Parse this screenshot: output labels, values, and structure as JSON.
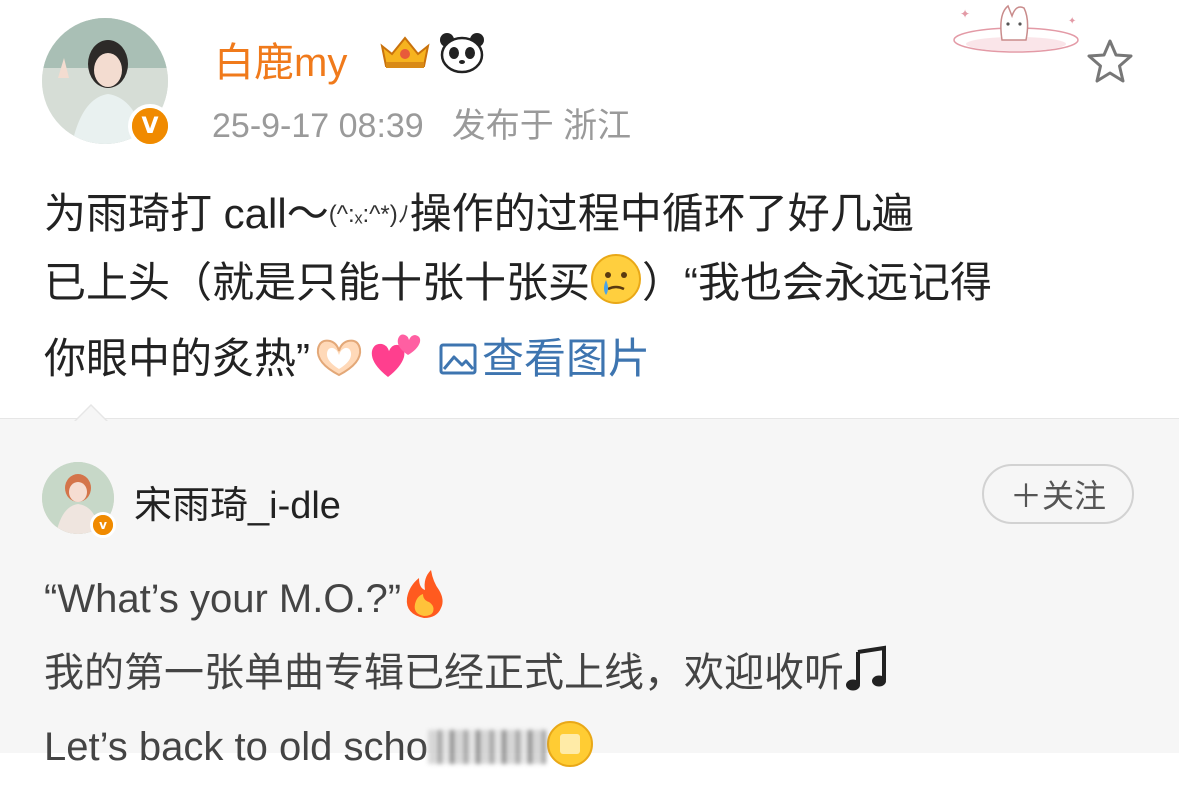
{
  "post": {
    "username": "白鹿my",
    "badges": [
      "crown-badge-icon",
      "panda-icon"
    ],
    "time": "25-9-17 08:39",
    "location": "发布于 浙江",
    "body_line1_a": "为雨琦打 call～",
    "kaomoji": "(^:ₓ:^*)ﾉ",
    "body_line1_b": "操作的过程中循环了好几遍",
    "body_line2_a": "已上头（就是只能十张十张买",
    "body_line2_b": "）“我也会永远记得",
    "body_line3_a": "你眼中的炙热”",
    "view_pics_label": "查看图片",
    "favorite_icon": "star-icon",
    "verified_badge": "V"
  },
  "repost": {
    "username": "宋雨琦_i-dle",
    "follow_label": "＋关注",
    "verified_badge": "v",
    "line1": "“What’s your M.O.?”",
    "line2": "我的第一张单曲专辑已经正式上线，欢迎收听",
    "line3": "Let’s back to old scho"
  },
  "colors": {
    "username_orange": "#f07a1b",
    "link_blue": "#3e75b0",
    "meta_gray": "#9a9a9a",
    "repost_bg": "#f6f6f6",
    "verified_gold": "#f5a300"
  }
}
